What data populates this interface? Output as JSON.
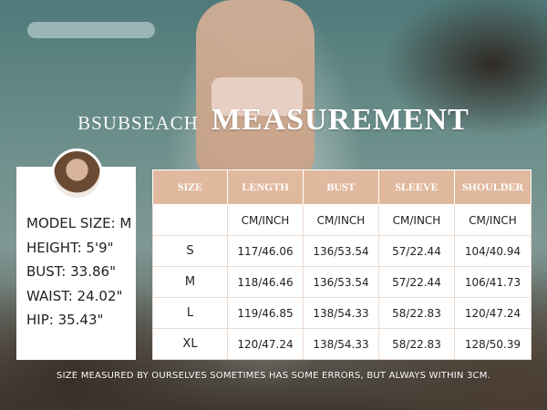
{
  "header": {
    "brand": "BSUBSEACH",
    "title": "MEASUREMENT"
  },
  "model": {
    "lines": [
      "MODEL SIZE: M",
      "HEIGHT: 5'9\"",
      "BUST: 33.86\"",
      "WAIST: 24.02\"",
      "HIP: 35.43\""
    ]
  },
  "table": {
    "headers": [
      "SIZE",
      "LENGTH",
      "BUST",
      "SLEEVE",
      "SHOULDER"
    ],
    "units": [
      "",
      "CM/INCH",
      "CM/INCH",
      "CM/INCH",
      "CM/INCH"
    ],
    "rows": [
      [
        "S",
        "117/46.06",
        "136/53.54",
        "57/22.44",
        "104/40.94"
      ],
      [
        "M",
        "118/46.46",
        "136/53.54",
        "57/22.44",
        "106/41.73"
      ],
      [
        "L",
        "119/46.85",
        "138/54.33",
        "58/22.83",
        "120/47.24"
      ],
      [
        "XL",
        "120/47.24",
        "138/54.33",
        "58/22.83",
        "128/50.39"
      ]
    ]
  },
  "note": "SIZE MEASURED BY OURSELVES SOMETIMES HAS SOME ERRORS, BUT ALWAYS WITHIN 3CM.",
  "colors": {
    "header_fill": "#e1b99e",
    "card_fill": "#ffffff"
  }
}
